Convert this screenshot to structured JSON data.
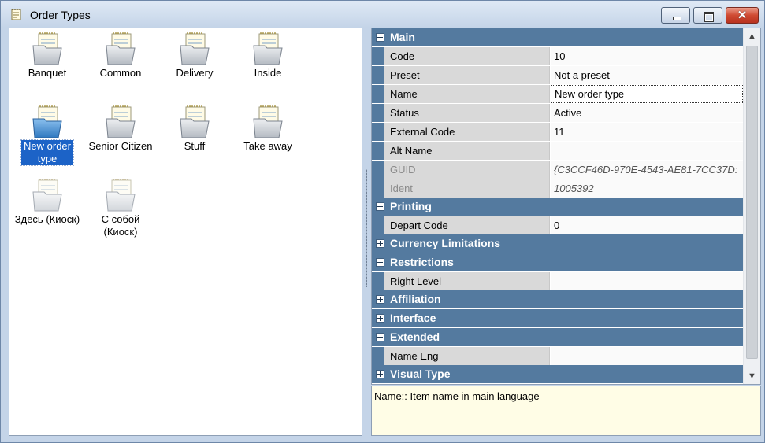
{
  "window": {
    "title": "Order Types",
    "controls": {
      "minimize": "minimize",
      "maximize": "maximize",
      "close": "✕"
    }
  },
  "order_types": [
    {
      "label": "Banquet",
      "selected": false
    },
    {
      "label": "Common",
      "selected": false
    },
    {
      "label": "Delivery",
      "selected": false
    },
    {
      "label": "Inside",
      "selected": false
    },
    {
      "label": "New order type",
      "selected": true
    },
    {
      "label": "Senior Citizen",
      "selected": false
    },
    {
      "label": "Stuff",
      "selected": false
    },
    {
      "label": "Take away",
      "selected": false
    },
    {
      "label": "Здесь (Киоск)",
      "selected": false
    },
    {
      "label": "С собой (Киоск)",
      "selected": false
    }
  ],
  "properties": {
    "main": {
      "label": "Main",
      "code": {
        "name": "Code",
        "value": "10"
      },
      "preset": {
        "name": "Preset",
        "value": "Not a preset"
      },
      "name": {
        "name": "Name",
        "value": "New order type"
      },
      "status": {
        "name": "Status",
        "value": "Active"
      },
      "external_code": {
        "name": "External Code",
        "value": "11"
      },
      "alt_name": {
        "name": "Alt Name",
        "value": ""
      },
      "guid": {
        "name": "GUID",
        "value": "{C3CCF46D-970E-4543-AE81-7CC37D:"
      },
      "ident": {
        "name": "Ident",
        "value": "1005392"
      }
    },
    "printing": {
      "label": "Printing",
      "depart_code": {
        "name": "Depart Code",
        "value": "0"
      }
    },
    "currency_limitations": {
      "label": "Currency Limitations"
    },
    "restrictions": {
      "label": "Restrictions",
      "right_level": {
        "name": "Right Level",
        "value": ""
      }
    },
    "affiliation": {
      "label": "Affiliation"
    },
    "interface": {
      "label": "Interface"
    },
    "extended": {
      "label": "Extended",
      "name_eng": {
        "name": "Name Eng",
        "value": ""
      }
    },
    "visual_type": {
      "label": "Visual Type"
    }
  },
  "description": "Name:: Item name in main language",
  "colors": {
    "category_bg": "#547a9f",
    "selection": "#1c63c7",
    "description_bg": "#fffde6"
  }
}
